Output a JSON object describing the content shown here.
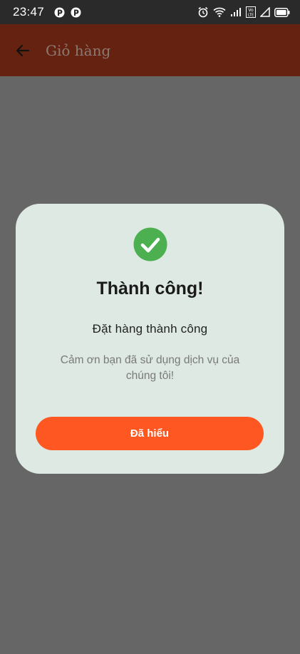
{
  "status_bar": {
    "time": "23:47",
    "icons": [
      "notification-app-icon",
      "notification-app-icon",
      "alarm-icon",
      "wifi-icon",
      "cellular-signal-icon",
      "volte-icon",
      "signal-icon",
      "battery-icon"
    ],
    "volte_label": "Vo LTE"
  },
  "app_bar": {
    "title": "Giỏ hàng",
    "back_icon": "arrow-left-icon",
    "background": "#662211"
  },
  "dialog": {
    "icon": "check-circle-icon",
    "icon_color": "#4caf50",
    "title": "Thành công!",
    "message": "Đặt hàng thành công",
    "sub_message": "Cảm ơn bạn đã sử dụng dịch vụ của chúng tôi!",
    "button_label": "Đã hiểu",
    "button_color": "#ff5722",
    "background": "#dde9e2"
  },
  "overlay_color": "#666666"
}
